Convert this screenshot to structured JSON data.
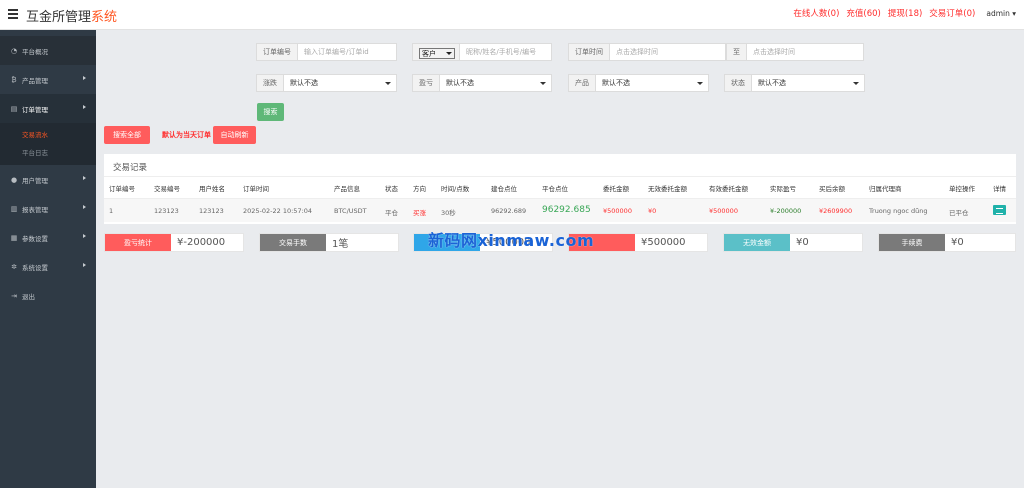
{
  "header": {
    "brand_main": "互金所管理",
    "brand_accent": "系统",
    "links": [
      "在线人数(0)",
      "充值(60)",
      "提现(18)",
      "交易订单(0)"
    ],
    "user": "admin"
  },
  "sidebar": {
    "items": [
      {
        "label": "平台概况",
        "icon": "dashboard-icon"
      },
      {
        "label": "产品管理",
        "icon": "bitcoin-icon"
      },
      {
        "label": "订单管理",
        "icon": "document-icon"
      },
      {
        "label": "用户管理",
        "icon": "user-icon"
      },
      {
        "label": "报表管理",
        "icon": "chart-icon"
      },
      {
        "label": "参数设置",
        "icon": "sliders-icon"
      },
      {
        "label": "系统设置",
        "icon": "gear-icon"
      },
      {
        "label": "退出",
        "icon": "logout-icon"
      }
    ],
    "subitems": [
      "交易流水",
      "平台日志"
    ]
  },
  "filters": {
    "order_no_label": "订单编号",
    "order_no_placeholder": "输入订单编号/订单id",
    "customer_select": "客户",
    "customer_placeholder": "昵称/姓名/手机号/编号",
    "time_label": "订单时间",
    "time_start_placeholder": "点击选择时间",
    "to_label": "至",
    "time_end_placeholder": "点击选择时间",
    "updown_label": "涨跌",
    "updown_value": "默认不选",
    "profit_label": "盈亏",
    "profit_value": "默认不选",
    "product_label": "产品",
    "product_value": "默认不选",
    "status_label": "状态",
    "status_value": "默认不选",
    "search_button": "搜索",
    "search_all_button": "搜索全部",
    "default_note": "默认为当天订单",
    "auto_refresh_button": "自动刷新"
  },
  "table": {
    "title": "交易记录",
    "headers": [
      "订单编号",
      "交易编号",
      "用户姓名",
      "订单时间",
      "产品信息",
      "状态",
      "方向",
      "时间/点数",
      "建仓点位",
      "平仓点位",
      "委托金额",
      "无效委托金额",
      "有效委托金额",
      "实际盈亏",
      "买后余额",
      "归属代理商",
      "单控操作",
      "详情"
    ],
    "rows": [
      [
        "1",
        "123123",
        "123123",
        "2025-02-22 10:57:04",
        "BTC/USDT",
        "平仓",
        "买涨",
        "30秒",
        "96292.689",
        "96292.685",
        "¥500000",
        "¥0",
        "¥500000",
        "¥-200000",
        "¥2609900",
        "Truong ngoc dũng",
        "已平仓"
      ]
    ]
  },
  "stats": [
    {
      "label": "盈亏统计",
      "value": "¥-200000",
      "color": "#ff5c5c"
    },
    {
      "label": "交易手数",
      "value": "1笔",
      "color": "#7a7a7a"
    },
    {
      "label": "",
      "value": "¥500000",
      "color": "#2fa6e8"
    },
    {
      "label": "",
      "value": "¥500000",
      "color": "#ff5c5c"
    },
    {
      "label": "无效金额",
      "value": "¥0",
      "color": "#5bc0c8"
    },
    {
      "label": "手续费",
      "value": "¥0",
      "color": "#7a7a7a"
    }
  ],
  "watermark": "新码网xinmaw.com"
}
